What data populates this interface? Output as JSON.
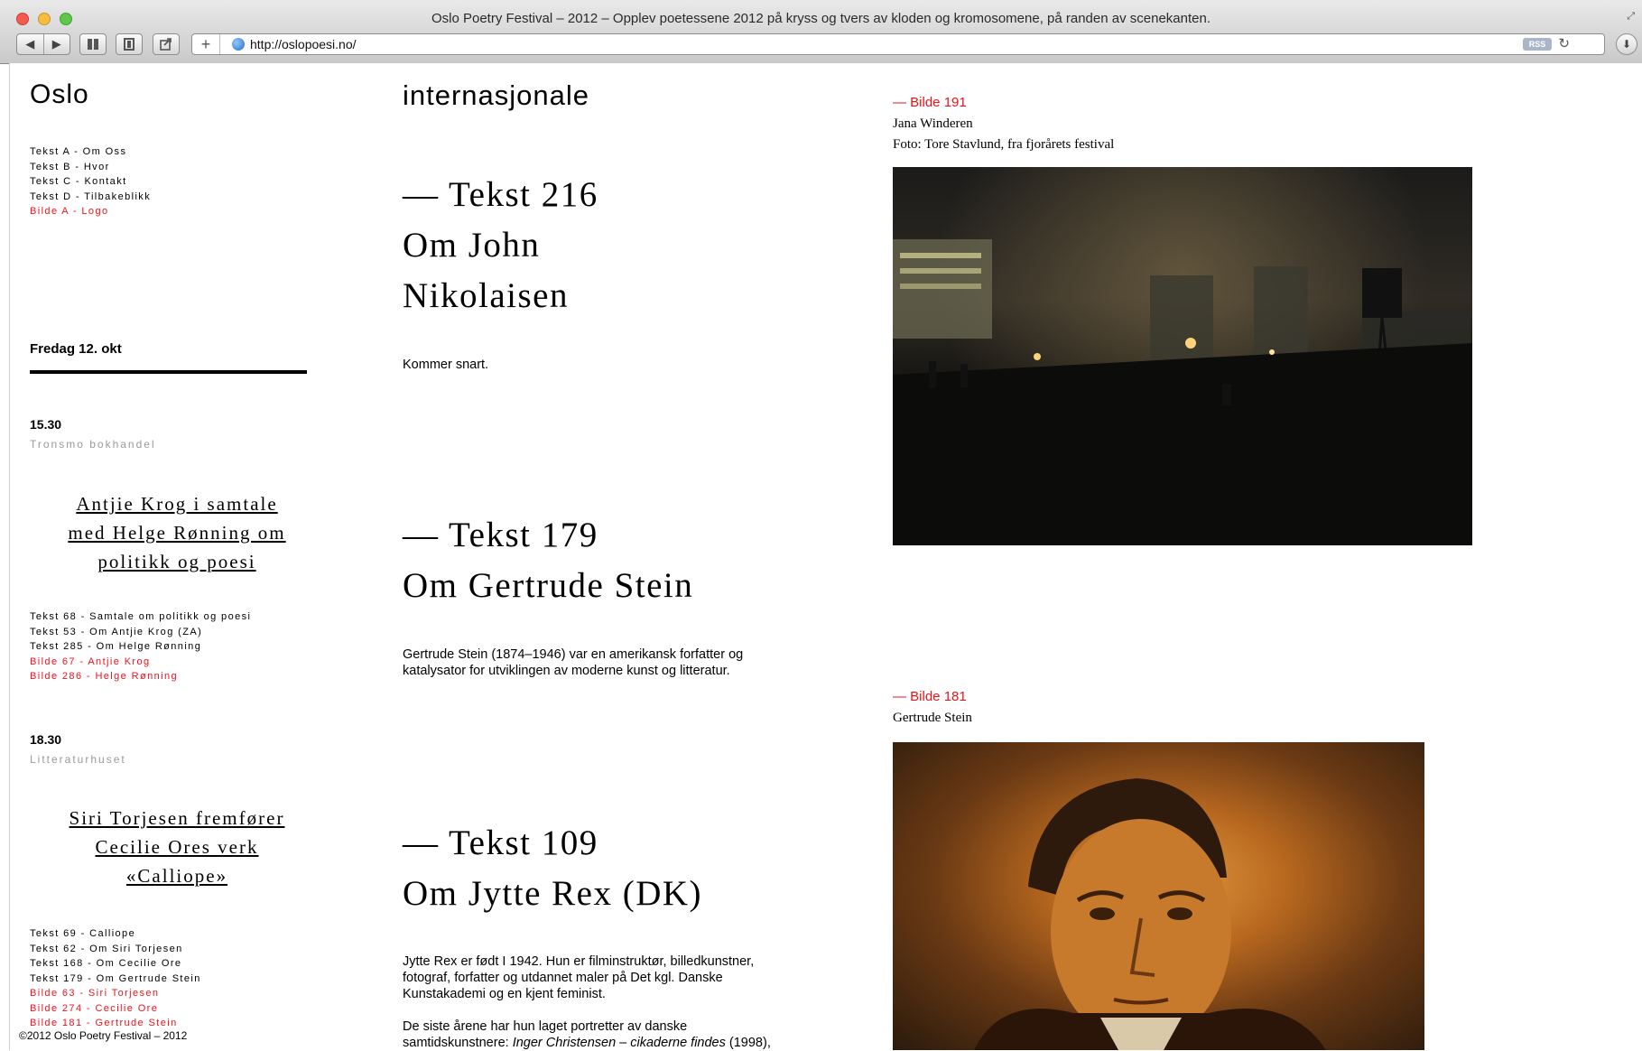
{
  "window": {
    "title": "Oslo Poetry Festival – 2012 – Opplev poetessene 2012 på kryss og tvers av kloden og kromosomene, på randen av scenekanten.",
    "url": "http://oslopoesi.no/",
    "rss_label": "RSS",
    "icons": [
      "back-icon",
      "forward-icon",
      "bookmarks-icon",
      "reader-icon",
      "share-icon",
      "plus-icon",
      "globe-icon",
      "reload-icon",
      "download-icon"
    ]
  },
  "site": {
    "title": "Oslo",
    "menu": [
      {
        "label": "Tekst A - Om Oss",
        "color": "#000000"
      },
      {
        "label": "Tekst B - Hvor",
        "color": "#000000"
      },
      {
        "label": "Tekst C - Kontakt",
        "color": "#000000"
      },
      {
        "label": "Tekst D - Tilbakeblikk",
        "color": "#000000"
      },
      {
        "label": "Bilde A - Logo",
        "color": "#e8141c"
      }
    ],
    "accent_color": "#e8141c"
  },
  "program": {
    "day_label": "Fredag 12. okt",
    "events": [
      {
        "time": "15.30",
        "venue": "Tronsmo bokhandel",
        "title_lines": [
          "Antjie Krog i samtale",
          "med Helge Rønning om",
          "politikk og poesi"
        ],
        "links": [
          "Tekst 68 - Samtale om politikk og poesi",
          "Tekst 53 - Om Antjie Krog (ZA)",
          "Tekst 285 - Om Helge Rønning",
          "Bilde 67 - Antjie Krog",
          "Bilde 286 - Helge Rønning"
        ]
      },
      {
        "time": "18.30",
        "venue": "Litteraturhuset",
        "title_lines": [
          "Siri Torjesen fremfører",
          "Cecilie Ores verk",
          "«Calliope»"
        ],
        "links": [
          "Tekst 69 - Calliope",
          "Tekst 62 - Om Siri Torjesen",
          "Tekst 168 - Om Cecilie Ore",
          "Tekst 179 - Om Gertrude Stein",
          "Bilde 63 - Siri Torjesen",
          "Bilde 274 - Cecilie Ore",
          "Bilde 181 - Gertrude Stein"
        ]
      }
    ],
    "footer": "©2012 Oslo Poetry Festival – 2012"
  },
  "main": {
    "heading": "internasjonale",
    "texts": [
      {
        "number_line": "— Tekst 216",
        "title_lines": [
          "Om John",
          "Nikolaisen"
        ],
        "body": [
          "Kommer snart."
        ]
      },
      {
        "number_line": "— Tekst 179",
        "title_lines": [
          "Om Gertrude Stein"
        ],
        "body": [
          "Gertrude Stein (1874–1946) var en amerikansk forfatter og",
          "katalysator for utviklingen av moderne kunst og litteratur."
        ]
      },
      {
        "number_line": "— Tekst 109",
        "title_lines": [
          "Om Jytte Rex (DK)"
        ],
        "body": [
          "Jytte Rex er født I 1942. Hun er filminstruktør, billedkunstner,",
          "fotograf, forfatter og utdannet maler på Det kgl. Danske",
          "Kunstakademi og en kjent feminist."
        ],
        "body2_prefix": "De siste årene har hun laget portretter av danske",
        "body2_line2_prefix": "samtidskunstnere: ",
        "body2_line2_italic": "Inger Christensen – cikaderne findes",
        "body2_line2_suffix": " (1998),"
      }
    ]
  },
  "images": [
    {
      "label": "— Bilde 191",
      "caption_lines": [
        "Jana Winderen",
        "Foto: Tore Stavlund, fra fjorårets festival"
      ]
    },
    {
      "label": "— Bilde 181",
      "caption_lines": [
        "Gertrude Stein"
      ]
    }
  ]
}
